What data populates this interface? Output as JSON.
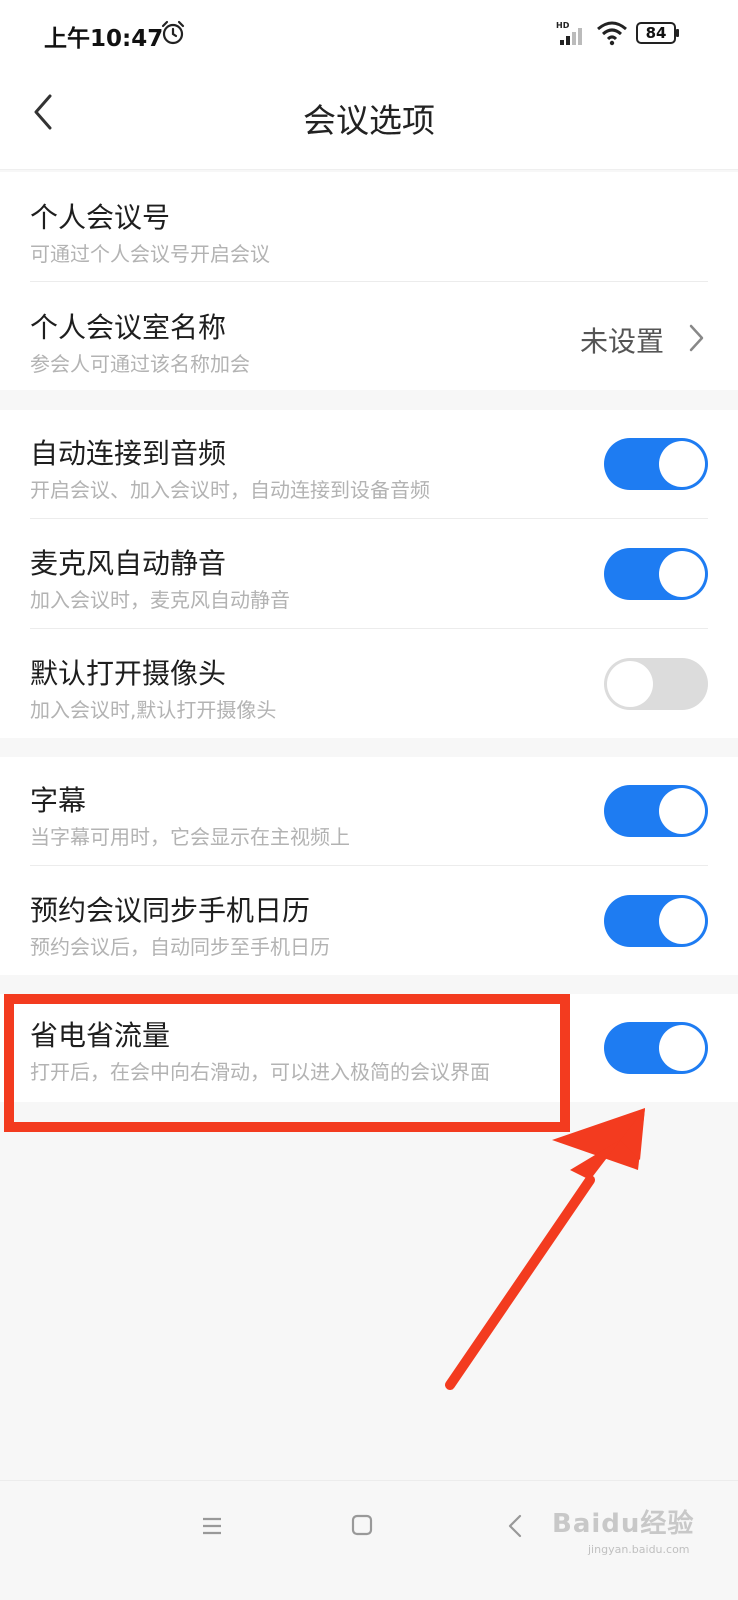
{
  "status_bar": {
    "time": "上午10:47",
    "battery": "84",
    "network_badge": "HD",
    "icons": [
      "alarm-icon",
      "signal-icon",
      "wifi-icon",
      "battery-icon"
    ]
  },
  "nav": {
    "title": "会议选项",
    "back_icon": "chevron-left-icon"
  },
  "sections": [
    {
      "rows": [
        {
          "title": "个人会议号",
          "subtitle": "可通过个人会议号开启会议"
        },
        {
          "title": "个人会议室名称",
          "subtitle": "参会人可通过该名称加会",
          "value": "未设置"
        }
      ]
    },
    {
      "rows": [
        {
          "title": "自动连接到音频",
          "subtitle": "开启会议、加入会议时，自动连接到设备音频",
          "toggle": "on"
        },
        {
          "title": "麦克风自动静音",
          "subtitle": "加入会议时，麦克风自动静音",
          "toggle": "on"
        },
        {
          "title": "默认打开摄像头",
          "subtitle": "加入会议时,默认打开摄像头",
          "toggle": "off"
        }
      ]
    },
    {
      "rows": [
        {
          "title": "字幕",
          "subtitle": "当字幕可用时，它会显示在主视频上",
          "toggle": "on"
        },
        {
          "title": "预约会议同步手机日历",
          "subtitle": "预约会议后，自动同步至手机日历",
          "toggle": "on"
        }
      ]
    },
    {
      "rows": [
        {
          "title": "省电省流量",
          "subtitle": "打开后，在会中向右滑动，可以进入极简的会议界面",
          "toggle": "on"
        }
      ]
    }
  ],
  "colors": {
    "toggle_on": "#1e7cf2",
    "toggle_off": "#dcdcdc",
    "annotation_red": "#f33b1f"
  },
  "watermark": {
    "text": "Baidu经验",
    "sub": "jingyan.baidu.com"
  }
}
